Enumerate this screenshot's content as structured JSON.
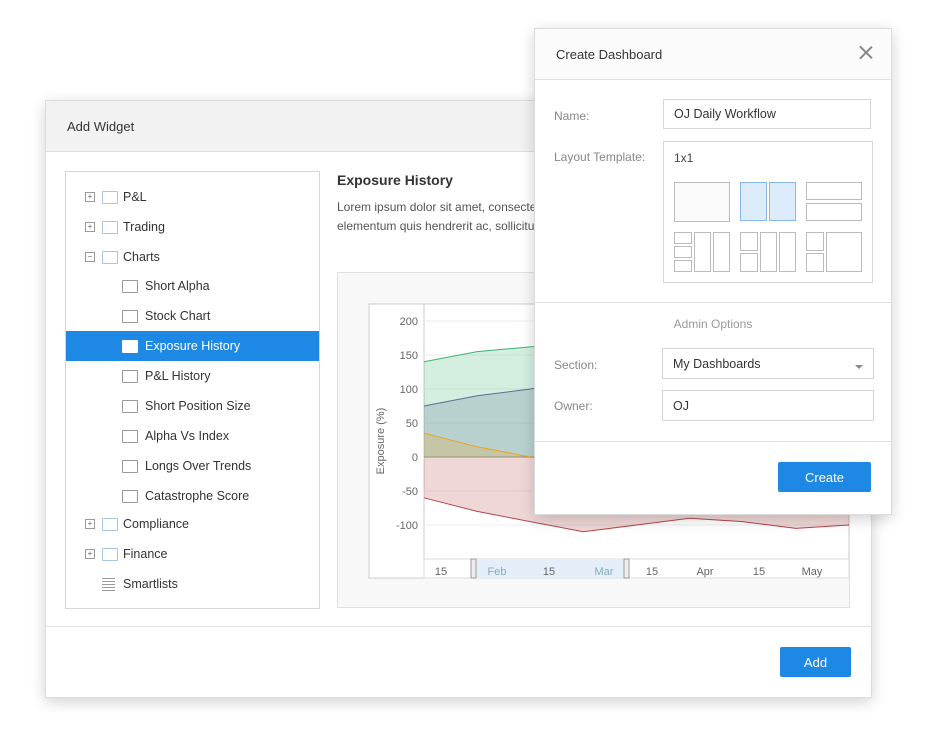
{
  "add_widget": {
    "title": "Add Widget",
    "add_label": "Add",
    "tree": [
      {
        "label": "P&L",
        "type": "folder",
        "expander": "+"
      },
      {
        "label": "Trading",
        "type": "folder",
        "expander": "+"
      },
      {
        "label": "Charts",
        "type": "folder",
        "expander": "−"
      },
      {
        "label": "Short Alpha",
        "type": "doc"
      },
      {
        "label": "Stock Chart",
        "type": "doc"
      },
      {
        "label": "Exposure History",
        "type": "doc",
        "selected": true
      },
      {
        "label": "P&L History",
        "type": "doc"
      },
      {
        "label": "Short Position Size",
        "type": "doc"
      },
      {
        "label": "Alpha Vs Index",
        "type": "doc"
      },
      {
        "label": "Longs Over Trends",
        "type": "doc"
      },
      {
        "label": "Catastrophe Score",
        "type": "doc"
      },
      {
        "label": "Compliance",
        "type": "folder",
        "expander": "+"
      },
      {
        "label": "Finance",
        "type": "folder",
        "expander": "+"
      },
      {
        "label": "Smartlists",
        "type": "list"
      }
    ],
    "detail": {
      "title": "Exposure History",
      "desc_line1": "Lorem ipsum dolor sit amet, consecte",
      "desc_line2": "elementum quis hendrerit ac, sollicitu"
    }
  },
  "chart_data": {
    "type": "area",
    "ylabel": "Exposure (%)",
    "y_ticks": [
      "200",
      "150",
      "100",
      "50",
      "0",
      "-50",
      "-100"
    ],
    "x_ticks": [
      "15",
      "Feb",
      "15",
      "Mar",
      "15",
      "Apr",
      "15",
      "May"
    ],
    "ylim": [
      -150,
      225
    ],
    "series": [
      {
        "color": "#3cb371",
        "values": [
          140,
          155,
          162,
          170,
          175,
          168,
          160,
          150,
          148
        ]
      },
      {
        "color": "#5a6f8c",
        "values": [
          75,
          90,
          100,
          112,
          105,
          98,
          95,
          92,
          100
        ]
      },
      {
        "color": "#f0a020",
        "values": [
          35,
          15,
          0,
          -10,
          -20,
          -25,
          -15,
          -5,
          -10
        ]
      },
      {
        "color": "#b5474a",
        "values": [
          -60,
          -80,
          -95,
          -110,
          -100,
          -90,
          -95,
          -105,
          -100
        ]
      }
    ]
  },
  "create_dashboard": {
    "title": "Create Dashboard",
    "name_label": "Name:",
    "name_value": "OJ Daily Workflow",
    "layout_label": "Layout Template:",
    "layout_value": "1x1",
    "admin_title": "Admin Options",
    "section_label": "Section:",
    "section_value": "My Dashboards",
    "owner_label": "Owner:",
    "owner_value": "OJ",
    "create_label": "Create"
  }
}
